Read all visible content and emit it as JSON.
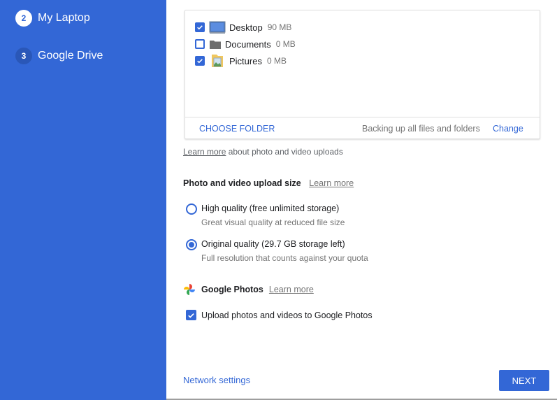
{
  "sidebar": {
    "steps": [
      {
        "number": "2",
        "label": "My Laptop",
        "state": "active"
      },
      {
        "number": "3",
        "label": "Google Drive",
        "state": "inactive"
      }
    ]
  },
  "folders": {
    "items": [
      {
        "name": "Desktop",
        "size": "90 MB",
        "checked": true,
        "icon": "desktop-folder-icon"
      },
      {
        "name": "Documents",
        "size": "0 MB",
        "checked": false,
        "icon": "folder-icon"
      },
      {
        "name": "Pictures",
        "size": "0 MB",
        "checked": true,
        "icon": "pictures-folder-icon"
      }
    ],
    "choose_folder_label": "CHOOSE FOLDER",
    "backing_up_text": "Backing up all files and folders",
    "change_label": "Change"
  },
  "learn_line": {
    "link": "Learn more",
    "text": " about photo and video uploads"
  },
  "upload_size": {
    "title": "Photo and video upload size",
    "learn_more": "Learn more",
    "options": [
      {
        "label": "High quality (free unlimited storage)",
        "sub": "Great visual quality at reduced file size",
        "selected": false
      },
      {
        "label": "Original quality (29.7 GB storage left)",
        "sub": "Full resolution that counts against your quota",
        "selected": true
      }
    ]
  },
  "google_photos": {
    "title": "Google Photos",
    "learn_more": "Learn more",
    "upload_label": "Upload photos and videos to Google Photos",
    "upload_checked": true
  },
  "footer": {
    "network_settings": "Network settings",
    "next": "NEXT"
  },
  "colors": {
    "accent": "#3367d6"
  }
}
